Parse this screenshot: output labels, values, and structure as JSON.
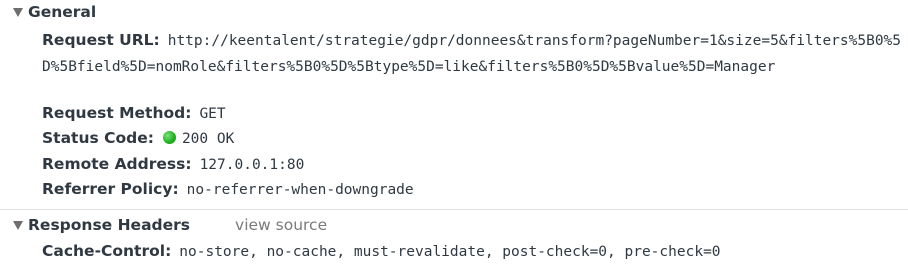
{
  "general": {
    "title": "General",
    "request_url_label": "Request URL:",
    "request_url_value": "http://keentalent/strategie/gdpr/donnees&transform?pageNumber=1&size=5&filters%5B0%5D%5Bfield%5D=nomRole&filters%5B0%5D%5Btype%5D=like&filters%5B0%5D%5Bvalue%5D=Manager",
    "request_method_label": "Request Method:",
    "request_method_value": "GET",
    "status_code_label": "Status Code:",
    "status_code_value": "200 OK",
    "status_color": "#20b520",
    "remote_address_label": "Remote Address:",
    "remote_address_value": "127.0.0.1:80",
    "referrer_policy_label": "Referrer Policy:",
    "referrer_policy_value": "no-referrer-when-downgrade"
  },
  "response_headers": {
    "title": "Response Headers",
    "view_source_label": "view source",
    "cache_control_label": "Cache-Control:",
    "cache_control_value": "no-store, no-cache, must-revalidate, post-check=0, pre-check=0"
  }
}
